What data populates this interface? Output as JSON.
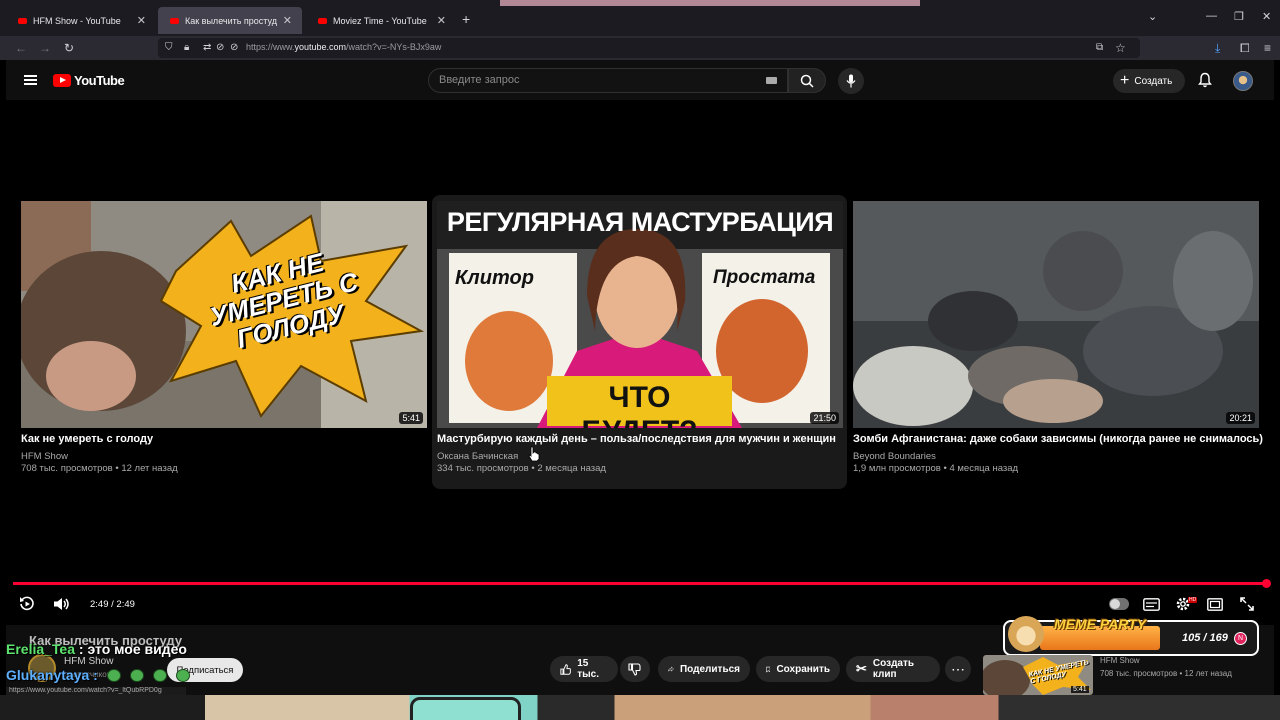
{
  "browser": {
    "tabs": [
      {
        "title": "HFM Show - YouTube",
        "active": false
      },
      {
        "title": "Как вылечить простуду - YouTube",
        "active": true
      },
      {
        "title": "Moviez Time - YouTube",
        "active": false
      }
    ],
    "url_prefix": "https://www.",
    "url_host": "youtube.com",
    "url_path": "/watch?v=-NYs-BJx9aw"
  },
  "header": {
    "logo_text": "YouTube",
    "search_placeholder": "Введите запрос",
    "create_label": "Создать"
  },
  "endscreen": {
    "videos": [
      {
        "title": "Как не умереть с голоду",
        "channel": "HFM Show",
        "views": "708 тыс. просмотров",
        "age": "12 лет назад",
        "duration": "5:41",
        "thumb_text": "КАК НЕ УМЕРЕТЬ С ГОЛОДУ"
      },
      {
        "title": "Мастурбирую каждый день – польза/последствия для мужчин и женщин",
        "channel": "Оксана Бачинская",
        "views": "334 тыс. просмотров",
        "age": "2 месяца назад",
        "duration": "21:50",
        "thumb_top": "РЕГУЛЯРНАЯ МАСТУРБАЦИЯ",
        "thumb_left": "Клитор",
        "thumb_right": "Простата",
        "thumb_bottom": "ЧТО БУДЕТ?"
      },
      {
        "title": "Зомби Афганистана: даже собаки зависимы (никогда ранее не снималось)",
        "channel": "Beyond Boundaries",
        "views": "1,9 млн просмотров",
        "age": "4 месяца назад",
        "duration": "20:21"
      }
    ]
  },
  "player": {
    "time": "2:49 / 2:49",
    "progress": 1.0,
    "accent": "#ff0033"
  },
  "below": {
    "video_title": "Как вылечить простуду",
    "channel_name": "HFM Show",
    "channel_subs": "подписчиков",
    "subscribe": "Подписаться",
    "likes": "15 тыс.",
    "share": "Поделиться",
    "save": "Сохранить",
    "clip": "Создать клип",
    "status_url": "https://www.youtube.com/watch?v=_ltQubRPD0g"
  },
  "overlay": {
    "chat": [
      {
        "nick": "Erelia_Tea",
        "sep": " : ",
        "text": "это мое видео"
      },
      {
        "nick": "Glukanytaya",
        "sep": " :",
        "text": ""
      }
    ],
    "meme_title": "MEME PARTY",
    "meme_count": "105 / 169",
    "mini_channel": "HFM Show",
    "mini_views": "708 тыс. просмотров",
    "mini_age": "12 лет назад",
    "mini_dur": "5:41"
  }
}
